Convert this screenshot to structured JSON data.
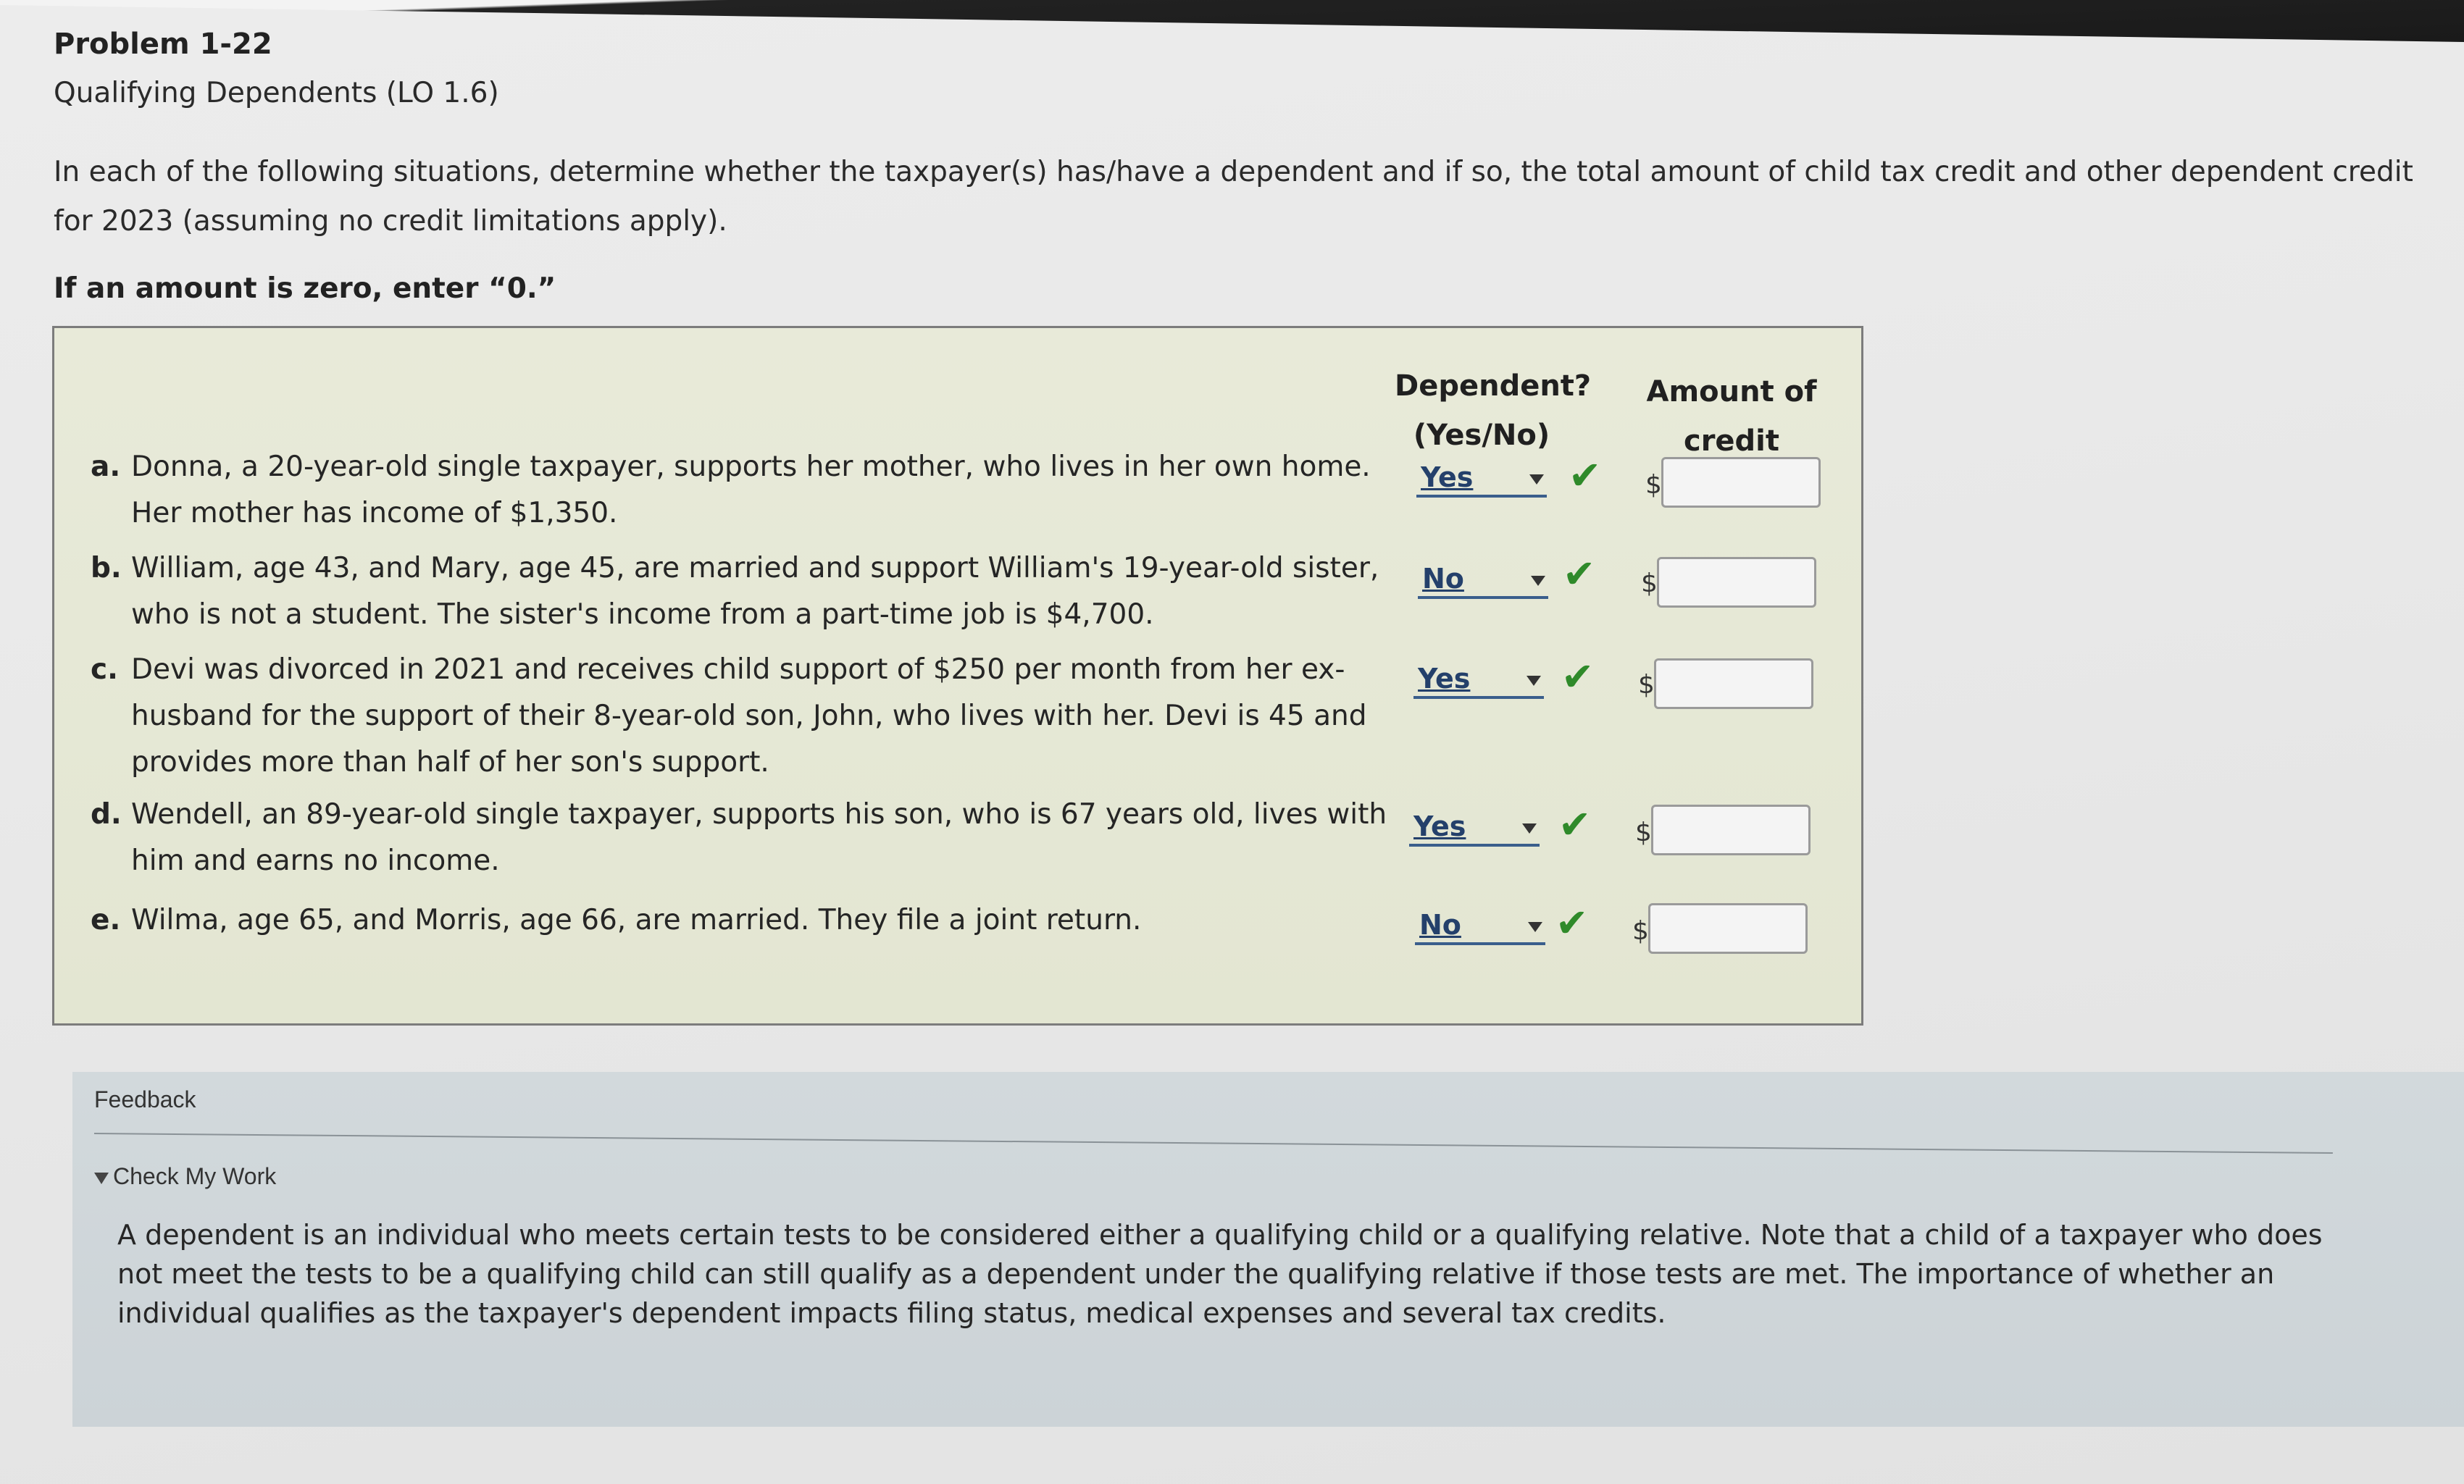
{
  "problem": {
    "title": "Problem 1-22",
    "subtitle": "Qualifying Dependents (LO 1.6)",
    "instructions": "In each of the following situations, determine whether the taxpayer(s) has/have a dependent and if so, the total amount of child tax credit and other dependent credit for 2023 (assuming no credit limitations apply).",
    "zero_note": "If an amount is zero, enter “0.”"
  },
  "table": {
    "col_dependent_line1": "Dependent?",
    "col_dependent_line2": "(Yes/No)",
    "col_amount_line1": "Amount of",
    "col_amount_line2": "credit",
    "currency_symbol": "$",
    "items": [
      {
        "letter": "a.",
        "text": "Donna, a 20-year-old single taxpayer, supports her mother, who lives in her own home. Her mother has income of $1,350.",
        "dependent": "Yes",
        "amount": ""
      },
      {
        "letter": "b.",
        "text": "William, age 43, and Mary, age 45, are married and support William's 19-year-old sister, who is not a student. The sister's income from a part-time job is $4,700.",
        "dependent": "No",
        "amount": ""
      },
      {
        "letter": "c.",
        "text": "Devi was divorced in 2021 and receives child support of $250 per month from her ex-husband for the support of their 8-year-old son, John, who lives with her. Devi is 45 and provides more than half of her son's support.",
        "dependent": "Yes",
        "amount": ""
      },
      {
        "letter": "d.",
        "text": "Wendell, an 89-year-old single taxpayer, supports his son, who is 67 years old, lives with him and earns no income.",
        "dependent": "Yes",
        "amount": ""
      },
      {
        "letter": "e.",
        "text": "Wilma, age 65, and Morris, age 66, are married. They file a joint return.",
        "dependent": "No",
        "amount": ""
      }
    ],
    "check_glyph": "✔"
  },
  "feedback": {
    "label": "Feedback",
    "check_my_work": "Check My Work",
    "text": "A dependent is an individual who meets certain tests to be considered either a qualifying child or a qualifying relative. Note that a child of a taxpayer who does not meet the tests to be a qualifying child can still qualify as a dependent under the qualifying relative if those tests are met. The importance of whether an individual qualifies as the taxpayer's dependent impacts filing status, medical expenses and several tax credits."
  },
  "colors": {
    "panel_bg": "#e5e8d5",
    "feedback_bg": "#cfd6da",
    "check_green": "#2f8a2a",
    "select_blue": "#24406b"
  }
}
